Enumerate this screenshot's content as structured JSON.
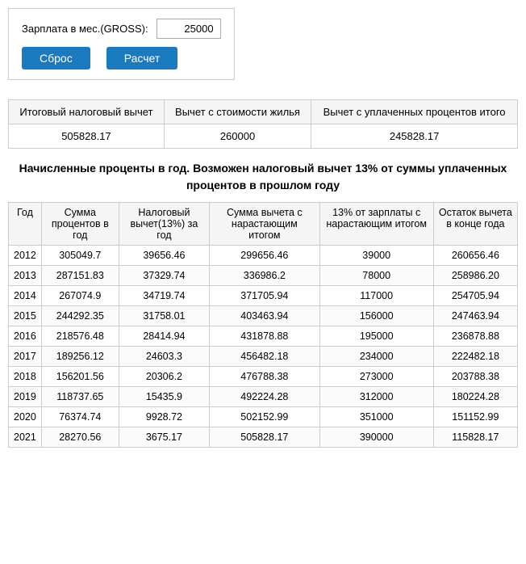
{
  "top": {
    "salary_label": "Зарплата в мес.(GROSS):",
    "salary_value": "25000",
    "reset_label": "Сброс",
    "calc_label": "Расчет"
  },
  "summary": {
    "col1_header": "Итоговый налоговый вычет",
    "col2_header": "Вычет с стоимости жилья",
    "col3_header": "Вычет с уплаченных процентов итого",
    "col1_value": "505828.17",
    "col2_value": "260000",
    "col3_value": "245828.17"
  },
  "notice": "Начисленные проценты в год. Возможен налоговый вычет 13% от суммы уплаченных процентов в прошлом году",
  "table": {
    "headers": [
      "Год",
      "Сумма процентов в год",
      "Налоговый вычет(13%) за год",
      "Сумма вычета с нарастающим итогом",
      "13% от зарплаты с нарастающим итогом",
      "Остаток вычета в конце года"
    ],
    "rows": [
      [
        "2012",
        "305049.7",
        "39656.46",
        "299656.46",
        "39000",
        "260656.46"
      ],
      [
        "2013",
        "287151.83",
        "37329.74",
        "336986.2",
        "78000",
        "258986.20"
      ],
      [
        "2014",
        "267074.9",
        "34719.74",
        "371705.94",
        "117000",
        "254705.94"
      ],
      [
        "2015",
        "244292.35",
        "31758.01",
        "403463.94",
        "156000",
        "247463.94"
      ],
      [
        "2016",
        "218576.48",
        "28414.94",
        "431878.88",
        "195000",
        "236878.88"
      ],
      [
        "2017",
        "189256.12",
        "24603.3",
        "456482.18",
        "234000",
        "222482.18"
      ],
      [
        "2018",
        "156201.56",
        "20306.2",
        "476788.38",
        "273000",
        "203788.38"
      ],
      [
        "2019",
        "118737.65",
        "15435.9",
        "492224.28",
        "312000",
        "180224.28"
      ],
      [
        "2020",
        "76374.74",
        "9928.72",
        "502152.99",
        "351000",
        "151152.99"
      ],
      [
        "2021",
        "28270.56",
        "3675.17",
        "505828.17",
        "390000",
        "115828.17"
      ]
    ]
  }
}
